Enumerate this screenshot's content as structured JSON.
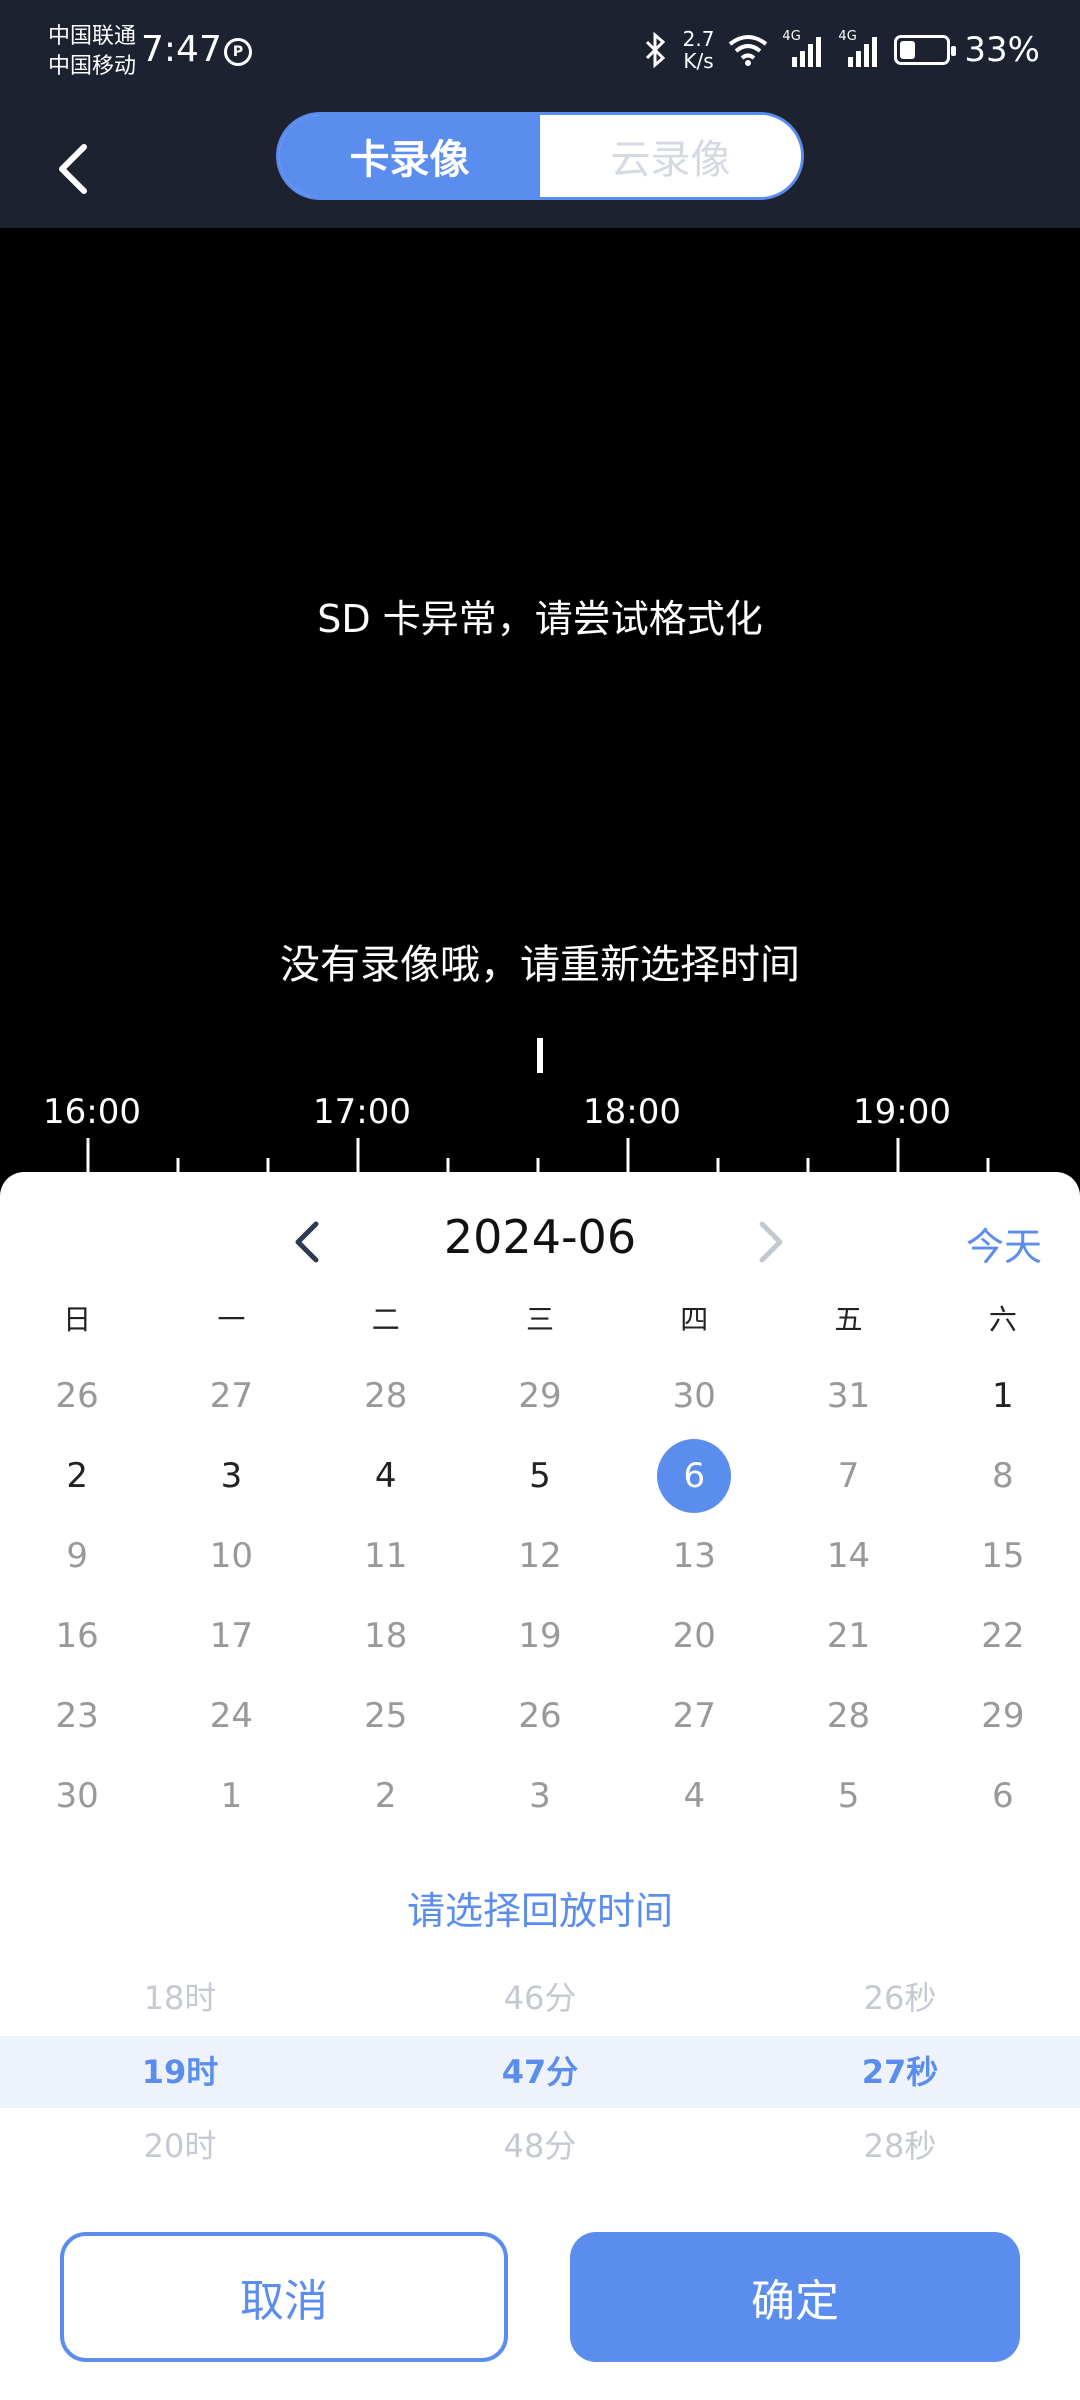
{
  "status_bar": {
    "carrier1": "中国联通",
    "carrier2": "中国移动",
    "time": "7:47",
    "net_speed_value": "2.7",
    "net_speed_unit": "K/s",
    "signal1_label": "4G",
    "signal2_label": "4G",
    "battery": "33%",
    "battery_level": 0.33
  },
  "header": {
    "tab_card": "卡录像",
    "tab_cloud": "云录像"
  },
  "video": {
    "sd_error": "SD 卡异常，请尝试格式化",
    "no_recording": "没有录像哦，请重新选择时间",
    "timeline_labels": [
      "16:00",
      "17:00",
      "18:00",
      "19:00"
    ]
  },
  "calendar": {
    "month": "2024-06",
    "today_label": "今天",
    "weekdays": [
      "日",
      "一",
      "二",
      "三",
      "四",
      "五",
      "六"
    ],
    "days": [
      {
        "d": "26",
        "s": "muted"
      },
      {
        "d": "27",
        "s": "muted"
      },
      {
        "d": "28",
        "s": "muted"
      },
      {
        "d": "29",
        "s": "muted"
      },
      {
        "d": "30",
        "s": "muted"
      },
      {
        "d": "31",
        "s": "muted"
      },
      {
        "d": "1",
        "s": "avail"
      },
      {
        "d": "2",
        "s": "avail"
      },
      {
        "d": "3",
        "s": "avail"
      },
      {
        "d": "4",
        "s": "avail"
      },
      {
        "d": "5",
        "s": "avail"
      },
      {
        "d": "6",
        "s": "selected"
      },
      {
        "d": "7",
        "s": "muted"
      },
      {
        "d": "8",
        "s": "muted"
      },
      {
        "d": "9",
        "s": "muted"
      },
      {
        "d": "10",
        "s": "muted"
      },
      {
        "d": "11",
        "s": "muted"
      },
      {
        "d": "12",
        "s": "muted"
      },
      {
        "d": "13",
        "s": "muted"
      },
      {
        "d": "14",
        "s": "muted"
      },
      {
        "d": "15",
        "s": "muted"
      },
      {
        "d": "16",
        "s": "muted"
      },
      {
        "d": "17",
        "s": "muted"
      },
      {
        "d": "18",
        "s": "muted"
      },
      {
        "d": "19",
        "s": "muted"
      },
      {
        "d": "20",
        "s": "muted"
      },
      {
        "d": "21",
        "s": "muted"
      },
      {
        "d": "22",
        "s": "muted"
      },
      {
        "d": "23",
        "s": "muted"
      },
      {
        "d": "24",
        "s": "muted"
      },
      {
        "d": "25",
        "s": "muted"
      },
      {
        "d": "26",
        "s": "muted"
      },
      {
        "d": "27",
        "s": "muted"
      },
      {
        "d": "28",
        "s": "muted"
      },
      {
        "d": "29",
        "s": "muted"
      },
      {
        "d": "30",
        "s": "muted"
      },
      {
        "d": "1",
        "s": "muted"
      },
      {
        "d": "2",
        "s": "muted"
      },
      {
        "d": "3",
        "s": "muted"
      },
      {
        "d": "4",
        "s": "muted"
      },
      {
        "d": "5",
        "s": "muted"
      },
      {
        "d": "6",
        "s": "muted"
      }
    ]
  },
  "time_picker": {
    "title": "请选择回放时间",
    "prev": [
      "18时",
      "46分",
      "26秒"
    ],
    "selected": [
      "19时",
      "47分",
      "27秒"
    ],
    "next": [
      "20时",
      "48分",
      "28秒"
    ]
  },
  "actions": {
    "cancel": "取消",
    "confirm": "确定"
  },
  "colors": {
    "accent": "#5b8def",
    "header_bg": "#1c2230"
  }
}
